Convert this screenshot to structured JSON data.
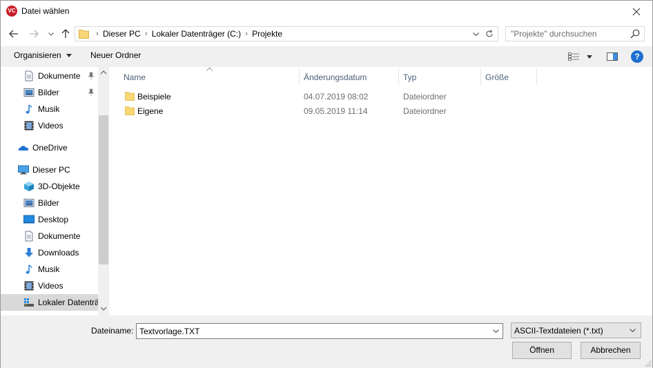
{
  "window": {
    "title": "Datei wählen",
    "logo_text": "VC"
  },
  "nav": {
    "back_icon": "arrow-left-icon",
    "forward_icon": "arrow-right-icon",
    "recent_icon": "chevron-down-icon",
    "up_icon": "arrow-up-icon"
  },
  "address": {
    "crumbs": [
      "Dieser PC",
      "Lokaler Datenträger (C:)",
      "Projekte"
    ]
  },
  "search": {
    "placeholder": "\"Projekte\" durchsuchen"
  },
  "commands": {
    "organize": "Organisieren",
    "new_folder": "Neuer Ordner",
    "help": "?"
  },
  "sidebar": {
    "items": [
      {
        "label": "Dokumente",
        "icon": "documents-icon",
        "pinned": true
      },
      {
        "label": "Bilder",
        "icon": "pictures-icon",
        "pinned": true
      },
      {
        "label": "Musik",
        "icon": "music-icon",
        "pinned": false
      },
      {
        "label": "Videos",
        "icon": "videos-icon",
        "pinned": false
      },
      {
        "label": "OneDrive",
        "icon": "onedrive-icon",
        "pinned": false
      },
      {
        "label": "Dieser PC",
        "icon": "this-pc-icon",
        "pinned": false
      },
      {
        "label": "3D-Objekte",
        "icon": "3d-objects-icon",
        "pinned": false
      },
      {
        "label": "Bilder",
        "icon": "pictures-icon",
        "pinned": false
      },
      {
        "label": "Desktop",
        "icon": "desktop-icon",
        "pinned": false
      },
      {
        "label": "Dokumente",
        "icon": "documents-icon",
        "pinned": false
      },
      {
        "label": "Downloads",
        "icon": "downloads-icon",
        "pinned": false
      },
      {
        "label": "Musik",
        "icon": "music-icon",
        "pinned": false
      },
      {
        "label": "Videos",
        "icon": "videos-icon",
        "pinned": false
      },
      {
        "label": "Lokaler Datenträ",
        "icon": "local-disk-icon",
        "pinned": false,
        "selected": true
      }
    ]
  },
  "filelist": {
    "columns": [
      "Name",
      "Änderungsdatum",
      "Typ",
      "Größe"
    ],
    "rows": [
      {
        "name": "Beispiele",
        "date": "04.07.2019 08:02",
        "type": "Dateiordner",
        "size": ""
      },
      {
        "name": "Eigene",
        "date": "09.05.2019 11:14",
        "type": "Dateiordner",
        "size": ""
      }
    ]
  },
  "bottom": {
    "filename_label": "Dateiname:",
    "filename_value": "Textvorlage.TXT",
    "filter_value": "ASCII-Textdateien (*.txt)",
    "open_label": "Öffnen",
    "cancel_label": "Abbrechen"
  },
  "colors": {
    "folder": "#f8d775",
    "help_accent": "#1e6fd0",
    "logo_red": "#c8202a",
    "header_text": "#4c607a",
    "selected_bg": "#d9d9d9"
  }
}
